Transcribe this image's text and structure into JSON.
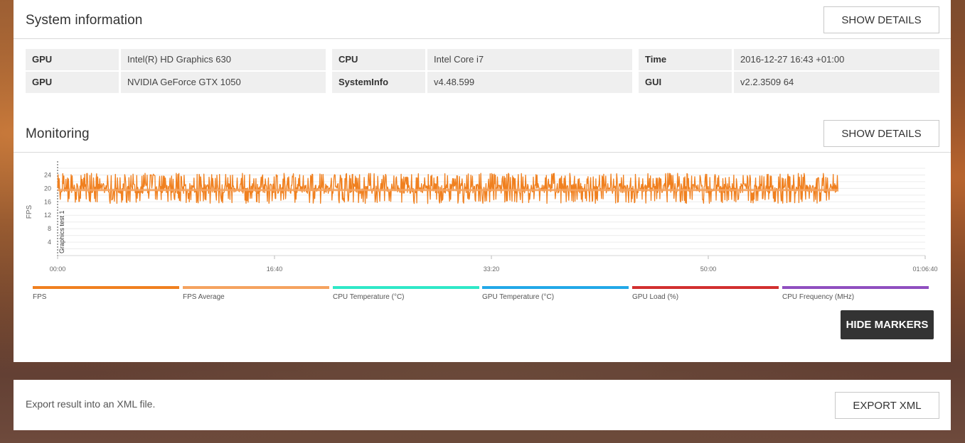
{
  "system_info": {
    "title": "System information",
    "show_details_label": "SHOW DETAILS",
    "rows": [
      [
        {
          "key": "GPU",
          "value": "Intel(R) HD Graphics 630"
        },
        {
          "key": "CPU",
          "value": "Intel Core i7"
        },
        {
          "key": "Time",
          "value": "2016-12-27 16:43 +01:00"
        }
      ],
      [
        {
          "key": "GPU",
          "value": "NVIDIA GeForce GTX 1050"
        },
        {
          "key": "SystemInfo",
          "value": "v4.48.599"
        },
        {
          "key": "GUI",
          "value": "v2.2.3509 64"
        }
      ]
    ]
  },
  "monitoring": {
    "title": "Monitoring",
    "show_details_label": "SHOW DETAILS",
    "hide_markers_label": "HIDE MARKERS",
    "legend": [
      {
        "label": "FPS",
        "color": "#f0801f"
      },
      {
        "label": "FPS Average",
        "color": "#f5a35f"
      },
      {
        "label": "CPU Temperature (°C)",
        "color": "#2fe8c8"
      },
      {
        "label": "GPU Temperature (°C)",
        "color": "#22a8e8"
      },
      {
        "label": "GPU Load (%)",
        "color": "#d22f2f"
      },
      {
        "label": "CPU Frequency (MHz)",
        "color": "#8f4fc0"
      }
    ]
  },
  "chart_data": {
    "type": "line",
    "ylabel": "FPS",
    "xlabel": "",
    "ylim": [
      0,
      26
    ],
    "xlim": [
      0,
      4000
    ],
    "y_ticks": [
      4,
      8,
      12,
      16,
      20,
      24
    ],
    "x_ticks": [
      {
        "value": 0,
        "label": "00:00"
      },
      {
        "value": 1000,
        "label": "16:40"
      },
      {
        "value": 2000,
        "label": "33:20"
      },
      {
        "value": 3000,
        "label": "50:00"
      },
      {
        "value": 4000,
        "label": "01:06:40"
      }
    ],
    "grid": true,
    "marker": {
      "x": 0,
      "label": "Graphics test 1"
    },
    "series": [
      {
        "name": "FPS",
        "color": "#f0801f",
        "x_start": 0,
        "x_end": 3600,
        "min": 15.5,
        "max": 24.5,
        "typical": 20
      },
      {
        "name": "FPS Average",
        "color": "#f5a35f",
        "x_start": 0,
        "x_end": 3600,
        "value": 19.5
      }
    ]
  },
  "export": {
    "text": "Export result into an XML file.",
    "button_label": "EXPORT XML"
  }
}
